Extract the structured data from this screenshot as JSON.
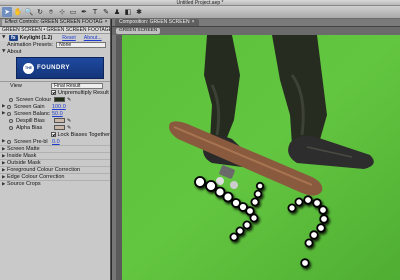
{
  "window": {
    "title": "Untitled Project.aep *"
  },
  "toolbar": {
    "tools": [
      {
        "icon": "selection-tool-icon",
        "glyph": "➤",
        "active": true
      },
      {
        "icon": "hand-tool-icon",
        "glyph": "✋",
        "active": false
      },
      {
        "icon": "zoom-tool-icon",
        "glyph": "🔍",
        "active": false
      },
      {
        "icon": "rotate-tool-icon",
        "glyph": "↻",
        "active": false
      },
      {
        "icon": "camera-tool-icon",
        "glyph": "⌾",
        "active": false
      },
      {
        "icon": "pan-behind-tool-icon",
        "glyph": "⊹",
        "active": false
      },
      {
        "icon": "rectangle-mask-tool-icon",
        "glyph": "▭",
        "active": false
      },
      {
        "icon": "pen-tool-icon",
        "glyph": "✒",
        "active": false
      },
      {
        "icon": "type-tool-icon",
        "glyph": "T",
        "active": false
      },
      {
        "icon": "brush-tool-icon",
        "glyph": "✎",
        "active": false
      },
      {
        "icon": "clone-stamp-tool-icon",
        "glyph": "♟",
        "active": false
      },
      {
        "icon": "eraser-tool-icon",
        "glyph": "◧",
        "active": false
      },
      {
        "icon": "puppet-tool-icon",
        "glyph": "✱",
        "active": false
      }
    ]
  },
  "effect_controls": {
    "tab_label": "Effect Controls: GREEN SCREEN FOOTAG",
    "close_glyph": "×",
    "comp_tab_label": "",
    "breadcrumb": "GREEN SCREEN • GREEN SCREEN FOOTAGE.mov",
    "effect_badge": "fx",
    "effect_name": "Keylight (1.2)",
    "reset_label": "Reset",
    "about_label": "About...",
    "animation_presets_label": "Animation Presets:",
    "animation_presets_value": "None",
    "about_section": "About",
    "logo_the": "THE",
    "logo_word": "FOUNDRY",
    "view_label": "View",
    "view_value": "Final Result",
    "unpremultiply_label": "Unpremultiply Result",
    "screen_colour_label": "Screen Colour",
    "screen_gain_label": "Screen Gain",
    "screen_gain_value": "100.0",
    "screen_balance_label": "Screen Balanc",
    "screen_balance_value": "50.0",
    "despill_bias_label": "Despill Bias",
    "alpha_bias_label": "Alpha Bias",
    "lock_biases_label": "Lock Biases Together",
    "screen_pre_blur_label": "Screen Pre-bl",
    "screen_pre_blur_value": "0.0",
    "groups": [
      "Screen Matte",
      "Inside Mask",
      "Outside Mask",
      "Foreground Colour Correction",
      "Edge Colour Correction",
      "Source Crops"
    ]
  },
  "composition": {
    "tab_label": "Composition: GREEN SCREEN",
    "close_glyph": "×",
    "sub_tab_label": "GREEN SCREEN"
  },
  "colors": {
    "green_screen": "#5fbf3a",
    "panel_bg": "#c9c9c9",
    "link_blue": "#1d3ccf"
  }
}
